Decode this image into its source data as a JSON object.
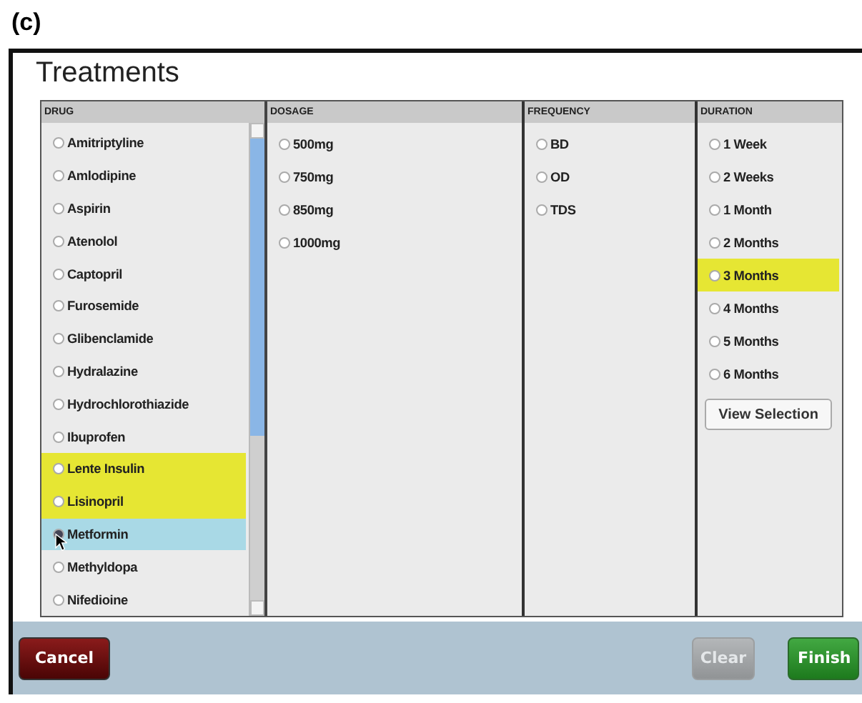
{
  "figure_label": "(c)",
  "window": {
    "title": "Treatments"
  },
  "columns": [
    {
      "heading": "DRUG",
      "scrollable": true,
      "items": [
        {
          "label": "Amitriptyline",
          "selected": false,
          "hovered": false
        },
        {
          "label": "Amlodipine",
          "selected": false,
          "hovered": false
        },
        {
          "label": "Aspirin",
          "selected": false,
          "hovered": false
        },
        {
          "label": "Atenolol",
          "selected": false,
          "hovered": false
        },
        {
          "label": "Captopril",
          "selected": false,
          "hovered": false
        },
        {
          "label": "Furosemide",
          "selected": false,
          "hovered": false
        },
        {
          "label": "Glibenclamide",
          "selected": false,
          "hovered": false
        },
        {
          "label": "Hydralazine",
          "selected": false,
          "hovered": false
        },
        {
          "label": "Hydrochlorothiazide",
          "selected": false,
          "hovered": false
        },
        {
          "label": "Ibuprofen",
          "selected": false,
          "hovered": false
        },
        {
          "label": "Lente Insulin",
          "selected": true,
          "hovered": false
        },
        {
          "label": "Lisinopril",
          "selected": true,
          "hovered": false
        },
        {
          "label": "Metformin",
          "selected": false,
          "hovered": true
        },
        {
          "label": "Methyldopa",
          "selected": false,
          "hovered": false
        },
        {
          "label": "Nifedioine",
          "selected": false,
          "hovered": false
        }
      ]
    },
    {
      "heading": "DOSAGE",
      "scrollable": false,
      "items": [
        {
          "label": "500mg",
          "selected": false,
          "hovered": false
        },
        {
          "label": "750mg",
          "selected": false,
          "hovered": false
        },
        {
          "label": "850mg",
          "selected": false,
          "hovered": false
        },
        {
          "label": "1000mg",
          "selected": false,
          "hovered": false
        }
      ]
    },
    {
      "heading": "FREQUENCY",
      "scrollable": false,
      "items": [
        {
          "label": "BD",
          "selected": false,
          "hovered": false
        },
        {
          "label": "OD",
          "selected": false,
          "hovered": false
        },
        {
          "label": "TDS",
          "selected": false,
          "hovered": false
        }
      ]
    },
    {
      "heading": "DURATION",
      "scrollable": false,
      "items": [
        {
          "label": "1 Week",
          "selected": false,
          "hovered": false
        },
        {
          "label": "2 Weeks",
          "selected": false,
          "hovered": false
        },
        {
          "label": "1 Month",
          "selected": false,
          "hovered": false
        },
        {
          "label": "2 Months",
          "selected": false,
          "hovered": false
        },
        {
          "label": "3 Months",
          "selected": true,
          "hovered": false
        },
        {
          "label": "4 Months",
          "selected": false,
          "hovered": false
        },
        {
          "label": "5 Months",
          "selected": false,
          "hovered": false
        },
        {
          "label": "6 Months",
          "selected": false,
          "hovered": false
        }
      ],
      "button": "View Selection"
    }
  ],
  "footer": {
    "buttons": [
      {
        "label": "Cancel",
        "kind": "cancel",
        "disabled": false
      },
      {
        "label": "Clear",
        "kind": "clear",
        "disabled": true
      },
      {
        "label": "Finish",
        "kind": "finish",
        "disabled": false
      }
    ]
  }
}
